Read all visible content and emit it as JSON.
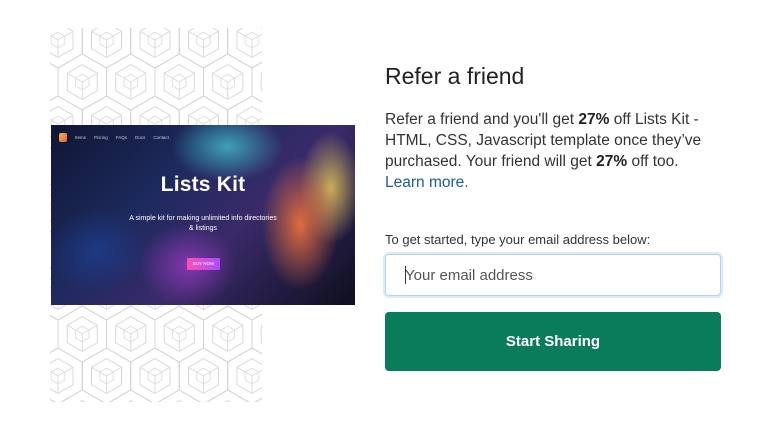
{
  "preview": {
    "nav_links": [
      "Items",
      "Pricing",
      "FAQs",
      "Docs",
      "Contact"
    ],
    "title": "Lists Kit",
    "subtitle": "A simple kit for making unlimited info directories & listings",
    "button_label": "BUY NOW"
  },
  "referral": {
    "heading": "Refer a friend",
    "description_part1": "Refer a friend and you'll get ",
    "discount_1": "27%",
    "description_part2": " off Lists Kit - HTML, CSS, Javascript template once they’ve purchased. Your friend will get ",
    "discount_2": "27%",
    "description_part3": " off too. ",
    "learn_more_link": "Learn more.",
    "email_label": "To get started, type your email address below:",
    "email_value": "",
    "email_placeholder": "Your email address",
    "share_button_label": "Start Sharing"
  },
  "colors": {
    "accent_button": "#0a7c5c",
    "link": "#1f5c94",
    "input_focus_border": "#b7d3ee"
  },
  "icons": [
    "hexagon-cube-pattern",
    "product-logo-icon"
  ]
}
